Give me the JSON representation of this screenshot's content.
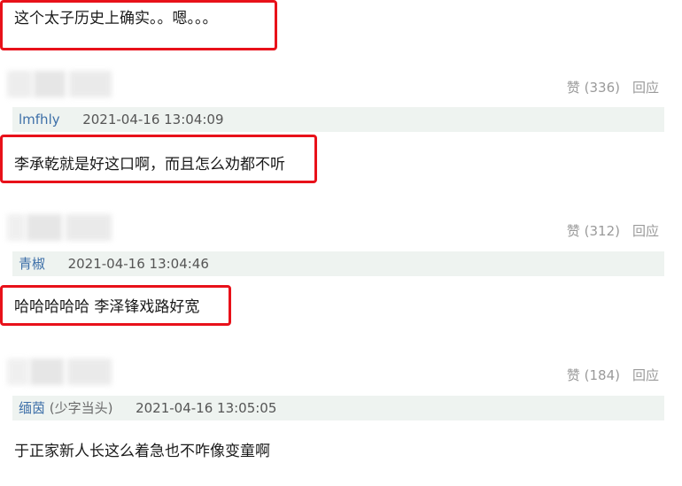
{
  "top_comment": {
    "text": "这个太子历史上确实。。嗯。。。"
  },
  "comments": [
    {
      "likes": "赞 (336)",
      "reply": "回应",
      "user": "lmfhly",
      "tag": "",
      "time": "2021-04-16 13:04:09",
      "text": "李承乾就是好这口啊，而且怎么劝都不听"
    },
    {
      "likes": "赞 (312)",
      "reply": "回应",
      "user": "青椒",
      "tag": "",
      "time": "2021-04-16 13:04:46",
      "text": "哈哈哈哈哈 李泽锋戏路好宽"
    },
    {
      "likes": "赞 (184)",
      "reply": "回应",
      "user": "缅茵",
      "tag": "(少字当头)",
      "time": "2021-04-16 13:05:05",
      "text": "于正家新人长这么着急也不咋像变童啊"
    }
  ],
  "colors": {
    "highlight_border": "#e8111a",
    "meta_bg": "#eef3f0",
    "username": "#3d6fa8"
  }
}
